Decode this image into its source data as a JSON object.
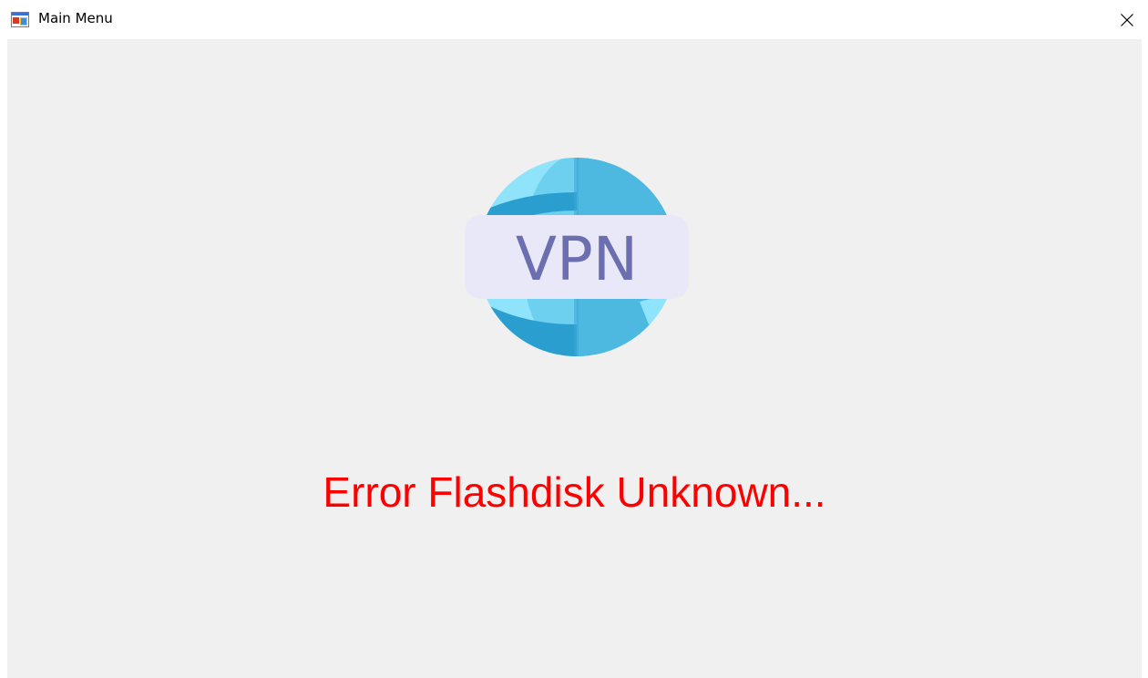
{
  "window": {
    "title": "Main Menu",
    "app_icon": "winforms-app-icon",
    "close_icon": "close-icon"
  },
  "content": {
    "logo": {
      "icon": "vpn-globe-icon",
      "label": "VPN"
    },
    "error_message": "Error Flashdisk Unknown...",
    "colors": {
      "background": "#f0f0f0",
      "error_text": "#ff0000",
      "vpn_text": "#6b6fb0",
      "vpn_badge": "#e8e8f8",
      "globe_light": "#8fe4fb",
      "globe_mid": "#6dd0ef",
      "globe_dark": "#2a9ecf"
    }
  }
}
